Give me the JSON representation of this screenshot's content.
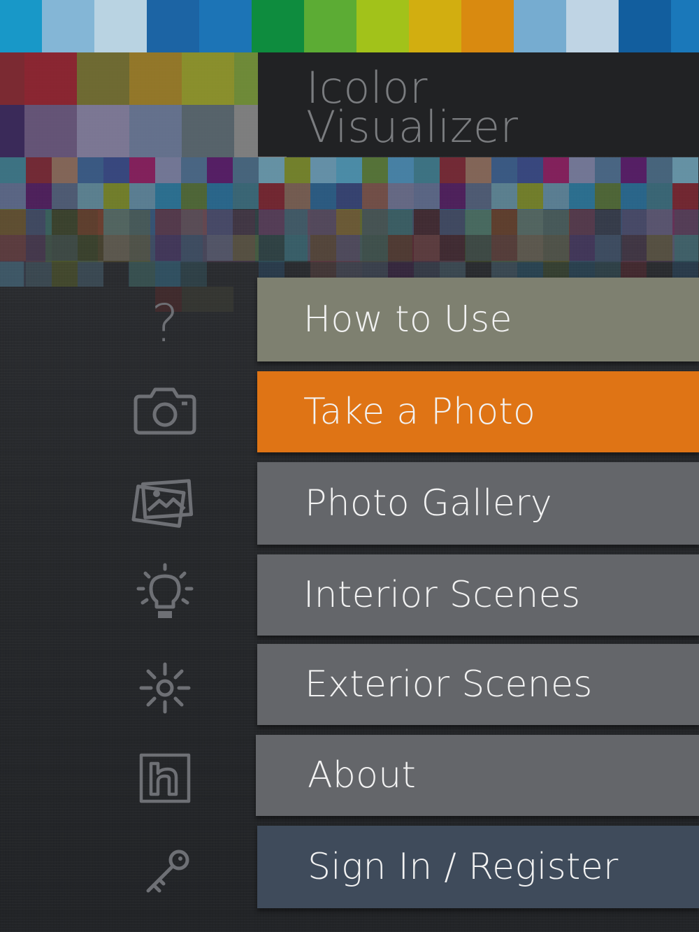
{
  "app": {
    "title_line1": "Icolor",
    "title_line2": "Visualizer"
  },
  "menu": [
    {
      "label": "How to Use",
      "icon": "question-mark-icon",
      "color": "#7e8070"
    },
    {
      "label": "Take a Photo",
      "icon": "camera-icon",
      "color": "#df7415"
    },
    {
      "label": "Photo Gallery",
      "icon": "photo-gallery-icon",
      "color": "#64666a"
    },
    {
      "label": "Interior Scenes",
      "icon": "lightbulb-icon",
      "color": "#64666a"
    },
    {
      "label": "Exterior Scenes",
      "icon": "sun-icon",
      "color": "#64666a"
    },
    {
      "label": "About",
      "icon": "brand-logo-icon",
      "color": "#64666a"
    },
    {
      "label": "Sign In / Register",
      "icon": "key-icon",
      "color": "#3f4b5b"
    }
  ],
  "colors": {
    "header_background": "#212224",
    "title_text": "#7b7d80",
    "icon_stroke": "#6e7075"
  }
}
